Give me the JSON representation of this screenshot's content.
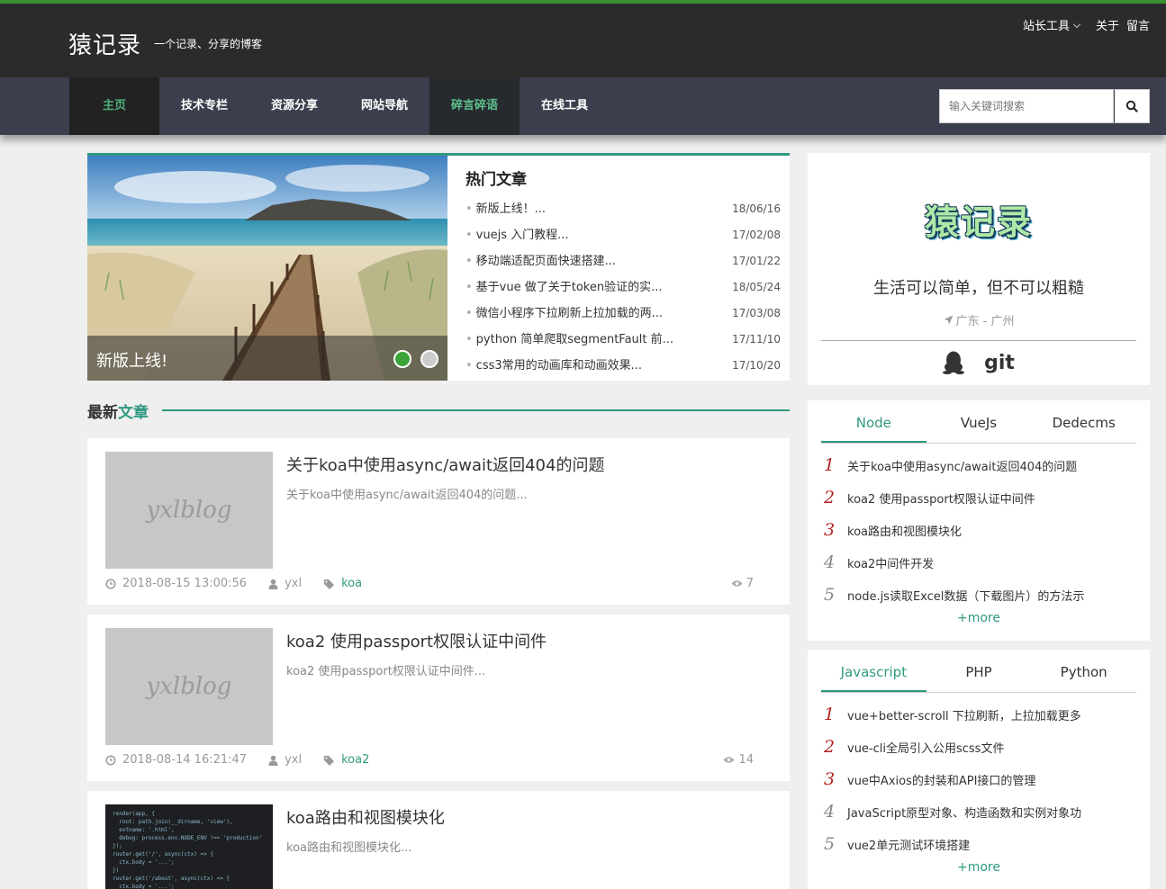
{
  "site": {
    "name": "猿记录",
    "slogan": "一个记录、分享的博客"
  },
  "toplinks": {
    "tools": "站长工具",
    "about": "关于",
    "message": "留言"
  },
  "nav": [
    {
      "label": "主页"
    },
    {
      "label": "技术专栏"
    },
    {
      "label": "资源分享"
    },
    {
      "label": "网站导航"
    },
    {
      "label": "碎言碎语"
    },
    {
      "label": "在线工具"
    }
  ],
  "search": {
    "placeholder": "输入关键词搜索"
  },
  "slider": {
    "caption": "新版上线!"
  },
  "hot": {
    "title": "热门文章",
    "items": [
      {
        "title": "新版上线！...",
        "date": "18/06/16"
      },
      {
        "title": "vuejs 入门教程...",
        "date": "17/02/08"
      },
      {
        "title": "移动端适配页面快速搭建...",
        "date": "17/01/22"
      },
      {
        "title": "基于vue 做了关于token验证的实...",
        "date": "18/05/24"
      },
      {
        "title": "微信小程序下拉刷新上拉加载的两...",
        "date": "17/03/08"
      },
      {
        "title": "python 简单爬取segmentFault 前...",
        "date": "17/11/10"
      },
      {
        "title": "css3常用的动画库和动画效果...",
        "date": "17/10/20"
      }
    ]
  },
  "latest": {
    "prefix": "最新",
    "accent": "文章"
  },
  "articles": [
    {
      "title": "关于koa中使用async/await返回404的问题",
      "summary": "关于koa中使用async/await返回404的问题...",
      "date": "2018-08-15 13:00:56",
      "author": "yxl",
      "tag": "koa",
      "views": "7",
      "thumb": "yxlblog"
    },
    {
      "title": "koa2 使用passport权限认证中间件",
      "summary": "koa2 使用passport权限认证中间件...",
      "date": "2018-08-14 16:21:47",
      "author": "yxl",
      "tag": "koa2",
      "views": "14",
      "thumb": "yxlblog"
    },
    {
      "title": "koa路由和视图模块化",
      "summary": "koa路由和视图模块化..."
    }
  ],
  "profile": {
    "brand": "猿记录",
    "motto": "生活可以简单，但不可以粗糙",
    "location": "广东 - 广州",
    "git": "git"
  },
  "tabbox1": {
    "tabs": [
      "Node",
      "VueJs",
      "Dedecms"
    ],
    "items": [
      {
        "n": "1",
        "title": "关于koa中使用async/await返回404的问题"
      },
      {
        "n": "2",
        "title": "koa2 使用passport权限认证中间件"
      },
      {
        "n": "3",
        "title": "koa路由和视图模块化"
      },
      {
        "n": "4",
        "title": "koa2中间件开发"
      },
      {
        "n": "5",
        "title": "node.js读取Excel数据（下载图片）的方法示"
      }
    ],
    "more": "+more"
  },
  "tabbox2": {
    "tabs": [
      "Javascript",
      "PHP",
      "Python"
    ],
    "items": [
      {
        "n": "1",
        "title": "vue+better-scroll 下拉刷新，上拉加载更多"
      },
      {
        "n": "2",
        "title": "vue-cli全局引入公用scss文件"
      },
      {
        "n": "3",
        "title": "vue中Axios的封装和API接口的管理"
      },
      {
        "n": "4",
        "title": "JavaScript原型对象、构造函数和实例对象功"
      },
      {
        "n": "5",
        "title": "vue2单元测试环境搭建"
      }
    ],
    "more": "+more"
  },
  "colors": {
    "accent": "#2f9980",
    "header": "#2b2b2b",
    "nav": "#3b3e4d",
    "green_bar": "#3a8f2e"
  }
}
